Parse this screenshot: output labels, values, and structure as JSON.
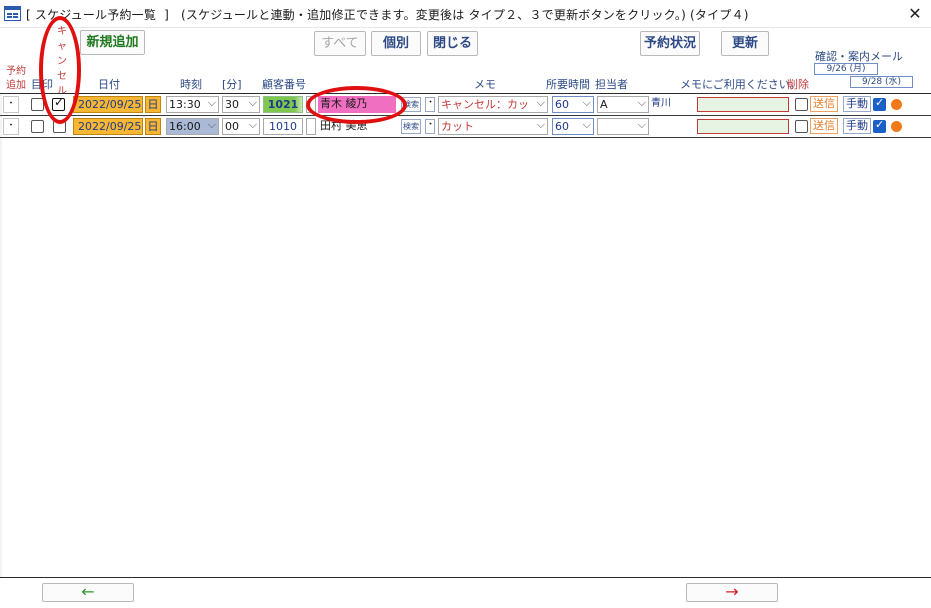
{
  "window": {
    "title": "[ スケジュール予約一覧  ]   (スケジュールと連動・追加修正できます。変更後は タイプ２、３で更新ボタンをクリック。) (タイプ４)",
    "close_label": "✕"
  },
  "toolbar": {
    "new_label": "新規追加",
    "all_label": "すべて",
    "individual_label": "個別",
    "close_label": "閉じる",
    "status_label": "予約状況",
    "update_label": "更新"
  },
  "mail": {
    "title": "確認・案内メール",
    "date1": "9/26 (月)",
    "date2": "9/28 (水)"
  },
  "headers": {
    "add": "予約",
    "add2": "追加",
    "mark": "目",
    "print": "印",
    "cancel": "キャンセル",
    "date": "日付",
    "time": "時刻",
    "minute": "[分]",
    "customer_no": "顧客番号",
    "memo": "メモ",
    "duration": "所要時間",
    "staff": "担当者",
    "note": "メモにご利用ください。",
    "delete": "削除"
  },
  "rows": [
    {
      "add": "・",
      "print_checked": false,
      "cancel_checked": true,
      "date": "2022/09/25",
      "day": "日",
      "time": "13:30",
      "minute": "30",
      "customer_no": "1021",
      "customer_name": "青木  綾乃",
      "search": "検索",
      "memo_dot": "・",
      "memo": "キャンセル：カッ",
      "duration": "60",
      "staff": "A",
      "staff_name": "青川",
      "note": "",
      "send": "送信",
      "manual": "手動"
    },
    {
      "add": "・",
      "print_checked": false,
      "cancel_checked": false,
      "date": "2022/09/25",
      "day": "日",
      "time": "16:00",
      "minute": "00",
      "customer_no": "1010",
      "customer_name": "田村  美恵",
      "search": "検索",
      "memo_dot": "・",
      "memo": "カット",
      "duration": "60",
      "staff": "",
      "staff_name": "",
      "note": "",
      "send": "送信",
      "manual": "手動"
    }
  ],
  "footer": {
    "prev_label": "←",
    "next_label": "→"
  },
  "colors": {
    "date_cell": "#f7b733",
    "customer_name_highlight": "#f06fc0",
    "customer_no_highlight": "#7ec850",
    "annotation": "#e01010"
  }
}
